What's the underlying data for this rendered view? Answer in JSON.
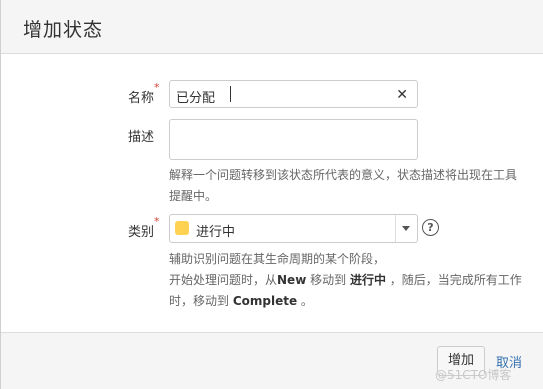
{
  "dialog": {
    "title": "增加状态"
  },
  "form": {
    "name": {
      "label": "名称",
      "required_mark": "*",
      "value": "已分配",
      "clear_glyph": "✕"
    },
    "description": {
      "label": "描述",
      "value": "",
      "help_line1": "解释一个问题转移到该状态所代表的意义，状态描述将出现在工具",
      "help_line2": "提醒中。"
    },
    "category": {
      "label": "类别",
      "required_mark": "*",
      "selected": "进行中",
      "swatch_color": "#ffd351",
      "help_icon": "question-circle-icon",
      "help_glyph": "?",
      "help_line1": "辅助识别问题在其生命周期的某个阶段，",
      "help_line2_pre": "开始处理问题时，从",
      "help_line2_bold1": "New",
      "help_line2_mid": " 移动到 ",
      "help_line2_bold2": "进行中",
      "help_line2_post": " ，随后，当完成所有工作",
      "help_line3_pre": "时，移动到 ",
      "help_line3_bold": "Complete",
      "help_line3_post": " 。"
    }
  },
  "footer": {
    "add_label": "增加",
    "cancel_label": "取消"
  },
  "watermark": "@51CTO博客",
  "colors": {
    "required": "#d04437",
    "link": "#3572b0",
    "header_bg": "#f5f5f5"
  }
}
